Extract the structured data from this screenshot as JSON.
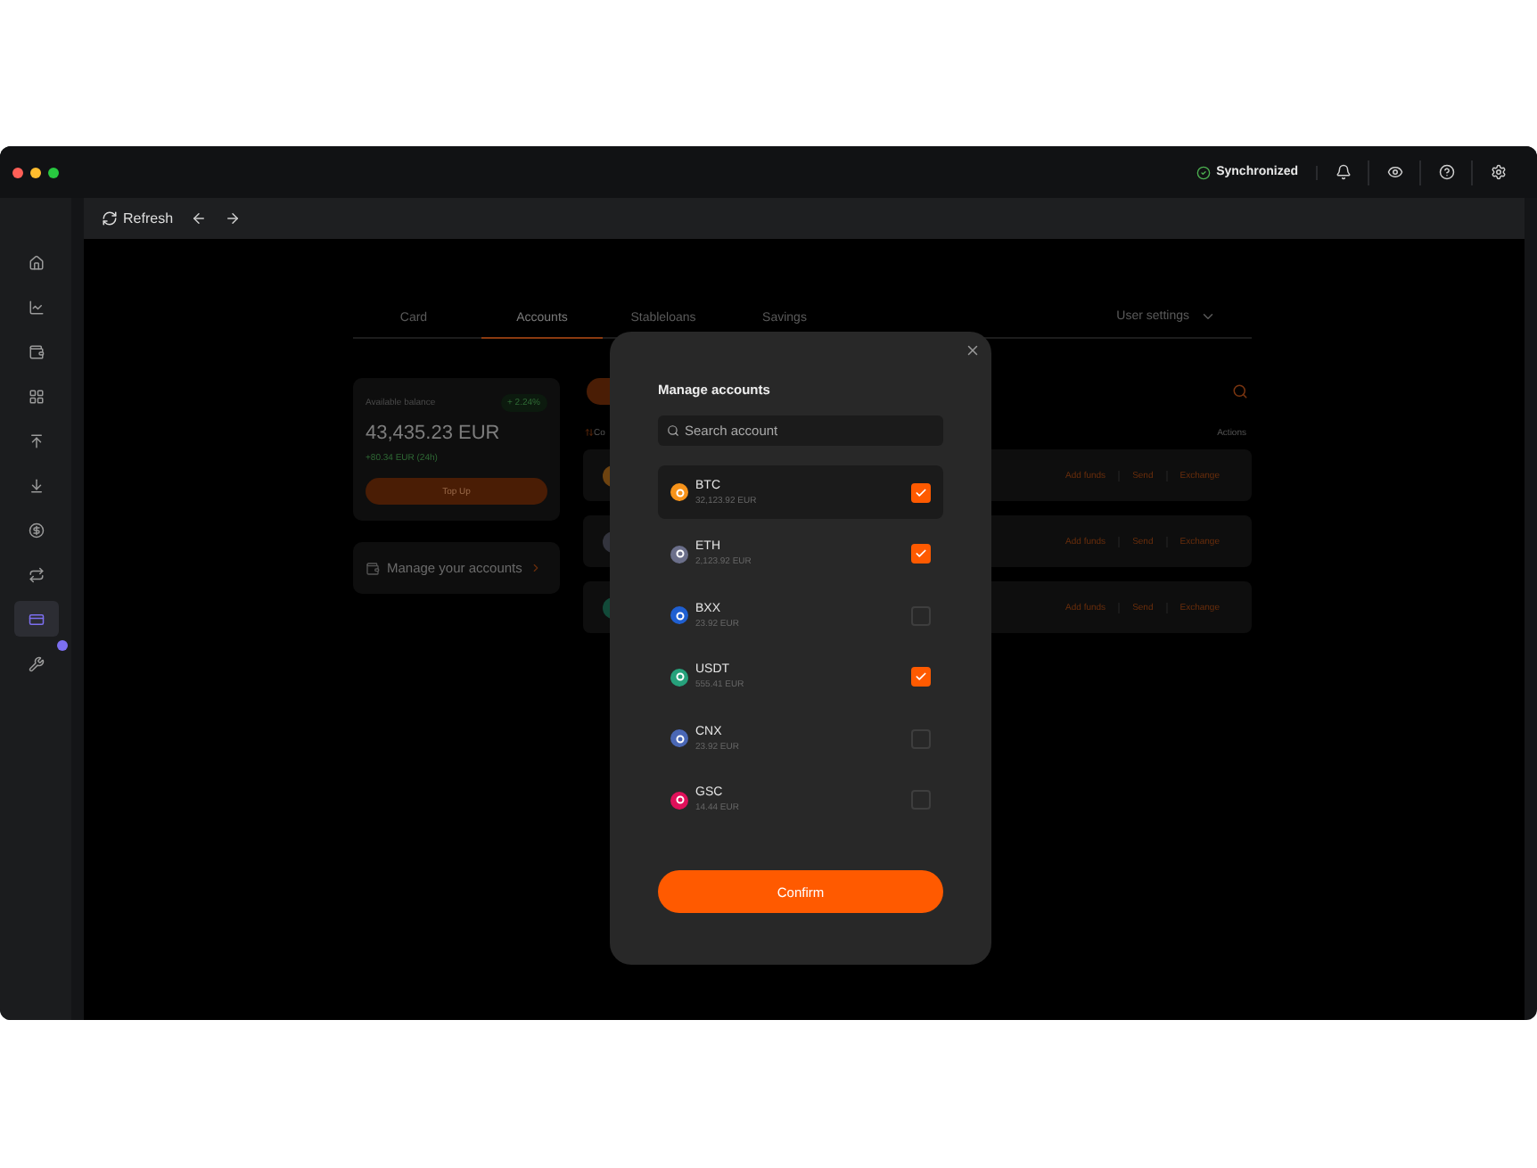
{
  "title_bar": {
    "status": "Synchronized"
  },
  "sidebar": {
    "items": [
      {
        "selected": false,
        "notification": false
      },
      {
        "selected": false,
        "notification": false
      },
      {
        "selected": false,
        "notification": false
      },
      {
        "selected": false,
        "notification": false
      },
      {
        "selected": false,
        "notification": false
      },
      {
        "selected": false,
        "notification": false
      },
      {
        "selected": false,
        "notification": false
      },
      {
        "selected": false,
        "notification": false
      },
      {
        "selected": true,
        "notification": false
      },
      {
        "selected": false,
        "notification": true
      }
    ]
  },
  "toolbar": {
    "refresh": "Refresh"
  },
  "tabs": [
    {
      "label": "Card",
      "selected": false
    },
    {
      "label": "Accounts",
      "selected": true
    },
    {
      "label": "Stableloans",
      "selected": false
    },
    {
      "label": "Savings",
      "selected": false
    }
  ],
  "user_settings": "User settings",
  "balance_card": {
    "label": "Available balance",
    "change": "+ 2.24%",
    "amount": "43,435.23 EUR",
    "daily": "+80.34 EUR (24h)",
    "top_up": "Top Up"
  },
  "manage_link": "Manage your accounts",
  "accounts_table": {
    "column_1": "Co",
    "actions_heading": "Actions",
    "rows": [
      {
        "color": "#6e4310",
        "actions": [
          "Add funds",
          "Send",
          "Exchange"
        ]
      },
      {
        "color": "#33343d",
        "actions": [
          "Add funds",
          "Send",
          "Exchange"
        ]
      },
      {
        "color": "#124a39",
        "actions": [
          "Add funds",
          "Send",
          "Exchange"
        ]
      }
    ]
  },
  "modal": {
    "title": "Manage accounts",
    "search": {
      "placeholder": "Search account"
    },
    "accounts": [
      {
        "symbol": "BTC",
        "amount": "32,123.92 EUR",
        "color": "#f7931a",
        "checked": true,
        "selected": true
      },
      {
        "symbol": "ETH",
        "amount": "2,123.92 EUR",
        "color": "#6b6f8a",
        "checked": true,
        "selected": false
      },
      {
        "symbol": "BXX",
        "amount": "23.92 EUR",
        "color": "#1f5fd1",
        "checked": false,
        "selected": false
      },
      {
        "symbol": "USDT",
        "amount": "555.41 EUR",
        "color": "#26a17b",
        "checked": true,
        "selected": false
      },
      {
        "symbol": "CNX",
        "amount": "23.92 EUR",
        "color": "#4a67b5",
        "checked": false,
        "selected": false
      },
      {
        "symbol": "GSC",
        "amount": "14.44 EUR",
        "color": "#e0105a",
        "checked": false,
        "selected": false
      }
    ],
    "confirm": "Confirm"
  }
}
